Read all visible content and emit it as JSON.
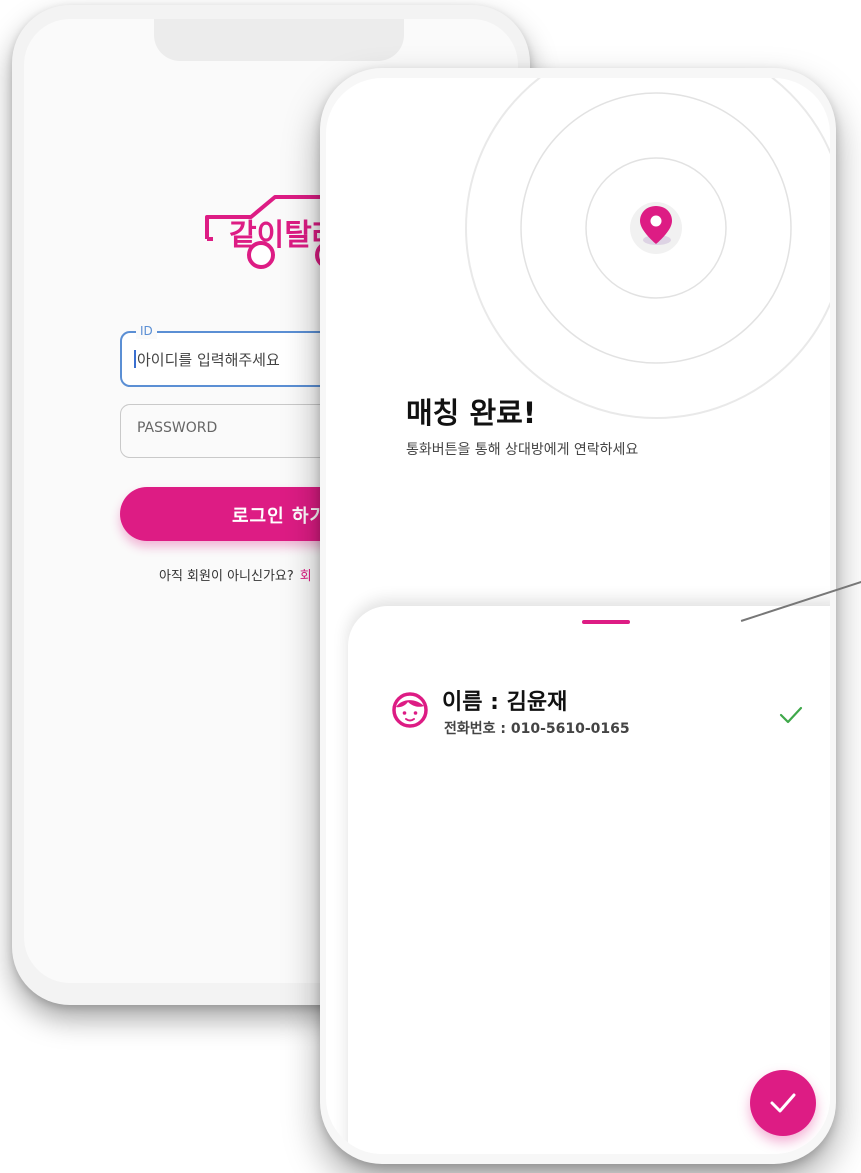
{
  "login": {
    "logo_text": "같이탈래",
    "id_label": "ID",
    "id_placeholder": "아이디를 입력해주세요",
    "password_placeholder": "PASSWORD",
    "login_button": "로그인 하기",
    "signup_prompt": "아직 회원이 아니신가요?",
    "signup_link": "회"
  },
  "match": {
    "title": "매칭 완료!",
    "subtitle": "통화버튼을 통해 상대방에게 연락하세요",
    "name_line": "이름 : 김윤재",
    "phone_line": "전화번호 : 010-5610-0165",
    "icons": {
      "location": "location-pin-icon",
      "face": "face-icon",
      "check": "check-icon",
      "confirm": "check-icon"
    }
  },
  "colors": {
    "brand": "#dd1c84",
    "focus": "#5b8fd4",
    "check": "#3fa84a"
  }
}
